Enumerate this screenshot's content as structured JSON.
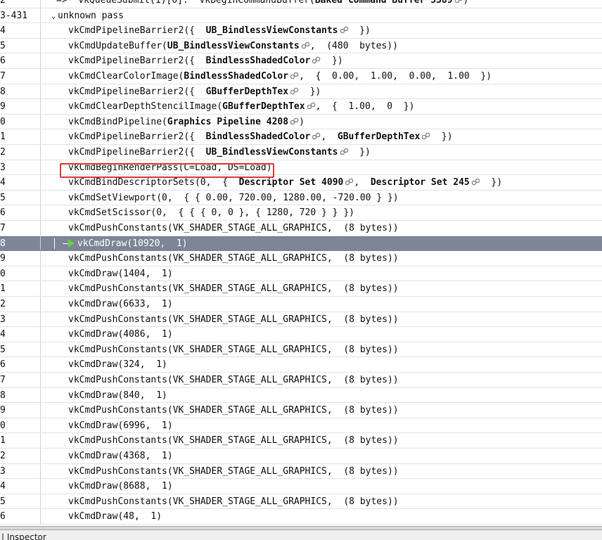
{
  "event_tree": {
    "rows": [
      {
        "eid": "2",
        "indent": 80,
        "segments": [
          {
            "t": "=>  vkQueueSubmit(1)[0]:  vkBeginCommandBuffer("
          },
          {
            "t": "Baked Command Buffer 5389",
            "b": true
          },
          {
            "icon": true
          },
          {
            "t": ")"
          }
        ]
      },
      {
        "eid": "3-431",
        "indent": 70,
        "pass": true,
        "segments": [
          {
            "t": "unknown pass"
          }
        ]
      },
      {
        "eid": "4",
        "indent": 97,
        "segments": [
          {
            "t": "vkCmdPipelineBarrier2({  "
          },
          {
            "t": "UB_BindlessViewConstants",
            "b": true
          },
          {
            "icon": true
          },
          {
            "t": "  })"
          }
        ]
      },
      {
        "eid": "5",
        "indent": 97,
        "segments": [
          {
            "t": "vkCmdUpdateBuffer("
          },
          {
            "t": "UB_BindlessViewConstants",
            "b": true
          },
          {
            "icon": true
          },
          {
            "t": ",  (480  bytes))"
          }
        ]
      },
      {
        "eid": "6",
        "indent": 97,
        "segments": [
          {
            "t": "vkCmdPipelineBarrier2({  "
          },
          {
            "t": "BindlessShadedColor",
            "b": true
          },
          {
            "icon": true
          },
          {
            "t": "  })"
          }
        ]
      },
      {
        "eid": "7",
        "indent": 97,
        "segments": [
          {
            "t": "vkCmdClearColorImage("
          },
          {
            "t": "BindlessShadedColor",
            "b": true
          },
          {
            "icon": true
          },
          {
            "t": ",  {  0.00,  1.00,  0.00,  1.00  })"
          }
        ]
      },
      {
        "eid": "8",
        "indent": 97,
        "segments": [
          {
            "t": "vkCmdPipelineBarrier2({  "
          },
          {
            "t": "GBufferDepthTex",
            "b": true
          },
          {
            "icon": true
          },
          {
            "t": "  })"
          }
        ]
      },
      {
        "eid": "9",
        "indent": 97,
        "segments": [
          {
            "t": "vkCmdClearDepthStencilImage("
          },
          {
            "t": "GBufferDepthTex",
            "b": true
          },
          {
            "icon": true
          },
          {
            "t": ",  {  1.00,  0  })"
          }
        ]
      },
      {
        "eid": "0",
        "indent": 97,
        "segments": [
          {
            "t": "vkCmdBindPipeline("
          },
          {
            "t": "Graphics Pipeline 4208",
            "b": true
          },
          {
            "icon": true
          },
          {
            "t": ")"
          }
        ]
      },
      {
        "eid": "1",
        "indent": 97,
        "segments": [
          {
            "t": "vkCmdPipelineBarrier2({  "
          },
          {
            "t": "BindlessShadedColor",
            "b": true
          },
          {
            "icon": true
          },
          {
            "t": ",  "
          },
          {
            "t": "GBufferDepthTex",
            "b": true
          },
          {
            "icon": true
          },
          {
            "t": "  })"
          }
        ]
      },
      {
        "eid": "2",
        "indent": 97,
        "segments": [
          {
            "t": "vkCmdPipelineBarrier2({  "
          },
          {
            "t": "UB_BindlessViewConstants",
            "b": true
          },
          {
            "icon": true
          },
          {
            "t": "  })"
          }
        ]
      },
      {
        "eid": "3",
        "indent": 97,
        "segments": [
          {
            "t": "vkCmdBeginRenderPass(C=Load, DS=Load)"
          }
        ]
      },
      {
        "eid": "4",
        "indent": 97,
        "segments": [
          {
            "t": "vkCmdBindDescriptorSets(0,  {  "
          },
          {
            "t": "Descriptor Set 4090",
            "b": true
          },
          {
            "icon": true
          },
          {
            "t": ",  "
          },
          {
            "t": "Descriptor Set 245",
            "b": true
          },
          {
            "icon": true
          },
          {
            "t": "  })"
          }
        ]
      },
      {
        "eid": "5",
        "indent": 97,
        "segments": [
          {
            "t": "vkCmdSetViewport(0,  { { 0.00, 720.00, 1280.00, -720.00 } })"
          }
        ]
      },
      {
        "eid": "6",
        "indent": 97,
        "segments": [
          {
            "t": "vkCmdSetScissor(0,  { { { 0, 0 }, { 1280, 720 } } })"
          }
        ]
      },
      {
        "eid": "7",
        "indent": 97,
        "segments": [
          {
            "t": "vkCmdPushConstants(VK_SHADER_STAGE_ALL_GRAPHICS,  (8 bytes))"
          }
        ]
      },
      {
        "eid": "8",
        "indent": 97,
        "selected": true,
        "segments": [
          {
            "t": "vkCmdDraw(10920,  1)"
          }
        ]
      },
      {
        "eid": "9",
        "indent": 97,
        "segments": [
          {
            "t": "vkCmdPushConstants(VK_SHADER_STAGE_ALL_GRAPHICS,  (8 bytes))"
          }
        ]
      },
      {
        "eid": "0",
        "indent": 97,
        "segments": [
          {
            "t": "vkCmdDraw(1404,  1)"
          }
        ]
      },
      {
        "eid": "1",
        "indent": 97,
        "segments": [
          {
            "t": "vkCmdPushConstants(VK_SHADER_STAGE_ALL_GRAPHICS,  (8 bytes))"
          }
        ]
      },
      {
        "eid": "2",
        "indent": 97,
        "segments": [
          {
            "t": "vkCmdDraw(6633,  1)"
          }
        ]
      },
      {
        "eid": "3",
        "indent": 97,
        "segments": [
          {
            "t": "vkCmdPushConstants(VK_SHADER_STAGE_ALL_GRAPHICS,  (8 bytes))"
          }
        ]
      },
      {
        "eid": "4",
        "indent": 97,
        "segments": [
          {
            "t": "vkCmdDraw(4086,  1)"
          }
        ]
      },
      {
        "eid": "5",
        "indent": 97,
        "segments": [
          {
            "t": "vkCmdPushConstants(VK_SHADER_STAGE_ALL_GRAPHICS,  (8 bytes))"
          }
        ]
      },
      {
        "eid": "6",
        "indent": 97,
        "segments": [
          {
            "t": "vkCmdDraw(324,  1)"
          }
        ]
      },
      {
        "eid": "7",
        "indent": 97,
        "segments": [
          {
            "t": "vkCmdPushConstants(VK_SHADER_STAGE_ALL_GRAPHICS,  (8 bytes))"
          }
        ]
      },
      {
        "eid": "8",
        "indent": 97,
        "segments": [
          {
            "t": "vkCmdDraw(840,  1)"
          }
        ]
      },
      {
        "eid": "9",
        "indent": 97,
        "segments": [
          {
            "t": "vkCmdPushConstants(VK_SHADER_STAGE_ALL_GRAPHICS,  (8 bytes))"
          }
        ]
      },
      {
        "eid": "0",
        "indent": 97,
        "segments": [
          {
            "t": "vkCmdDraw(6996,  1)"
          }
        ]
      },
      {
        "eid": "1",
        "indent": 97,
        "segments": [
          {
            "t": "vkCmdPushConstants(VK_SHADER_STAGE_ALL_GRAPHICS,  (8 bytes))"
          }
        ]
      },
      {
        "eid": "2",
        "indent": 97,
        "segments": [
          {
            "t": "vkCmdDraw(4368,  1)"
          }
        ]
      },
      {
        "eid": "3",
        "indent": 97,
        "segments": [
          {
            "t": "vkCmdPushConstants(VK_SHADER_STAGE_ALL_GRAPHICS,  (8 bytes))"
          }
        ]
      },
      {
        "eid": "4",
        "indent": 97,
        "segments": [
          {
            "t": "vkCmdDraw(8688,  1)"
          }
        ]
      },
      {
        "eid": "5",
        "indent": 97,
        "segments": [
          {
            "t": "vkCmdPushConstants(VK_SHADER_STAGE_ALL_GRAPHICS,  (8 bytes))"
          }
        ]
      },
      {
        "eid": "6",
        "indent": 97,
        "segments": [
          {
            "t": "vkCmdDraw(48,  1)"
          }
        ]
      }
    ],
    "highlighted_event_text": "vkCmdBeginRenderPass(C=Load, DS=Load)",
    "colors": {
      "selection": "#7d8597",
      "highlight_border": "#e23a3a",
      "play_icon": "#5dd33a"
    }
  },
  "bottom_panel": {
    "title": "Inspector"
  }
}
